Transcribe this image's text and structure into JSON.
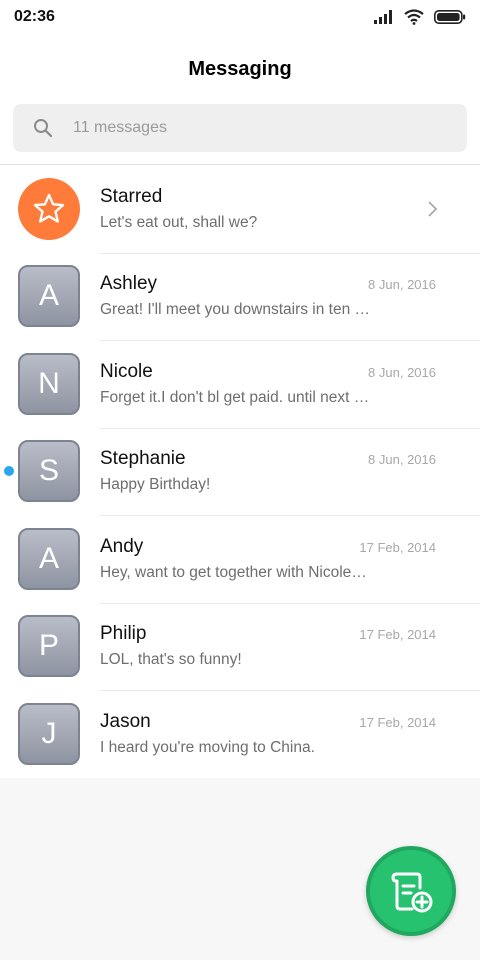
{
  "status_bar": {
    "time": "02:36"
  },
  "header": {
    "title": "Messaging"
  },
  "search": {
    "placeholder": "11 messages"
  },
  "starred": {
    "name": "Starred",
    "preview": "Let's eat out, shall we?"
  },
  "conversations": [
    {
      "initial": "A",
      "name": "Ashley",
      "date": "8 Jun, 2016",
      "preview": "Great! I'll meet you downstairs in ten …",
      "unread": false
    },
    {
      "initial": "N",
      "name": "Nicole",
      "date": "8 Jun, 2016",
      "preview": "Forget it.I don't bl get paid. until next …",
      "unread": false
    },
    {
      "initial": "S",
      "name": "Stephanie",
      "date": "8 Jun, 2016",
      "preview": "Happy Birthday!",
      "unread": true
    },
    {
      "initial": "A",
      "name": "Andy",
      "date": "17 Feb, 2014",
      "preview": "Hey, want to get together with Nicole…",
      "unread": false
    },
    {
      "initial": "P",
      "name": "Philip",
      "date": "17 Feb, 2014",
      "preview": "LOL, that's so funny!",
      "unread": false
    },
    {
      "initial": "J",
      "name": "Jason",
      "date": "17 Feb, 2014",
      "preview": "I heard you're moving to China.",
      "unread": false
    }
  ],
  "colors": {
    "accent": "#ff7b3a",
    "fab": "#26c270",
    "unread": "#2aa6f0"
  },
  "icons": {
    "search": "search-icon",
    "star": "star-icon",
    "chevron": "chevron-right-icon",
    "compose": "new-message-icon",
    "signal": "signal-icon",
    "wifi": "wifi-icon",
    "battery": "battery-icon"
  }
}
